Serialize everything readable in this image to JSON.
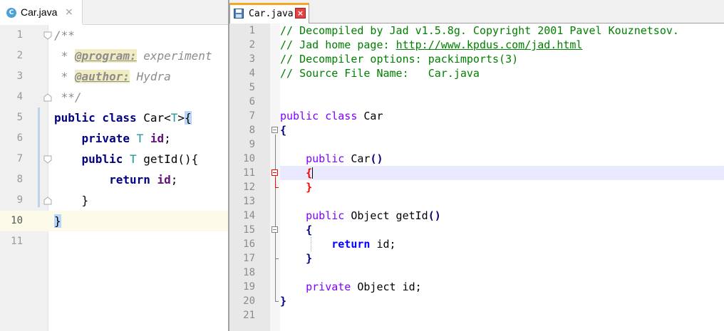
{
  "left_editor": {
    "tab": {
      "icon_letter": "C",
      "name": "Car.java",
      "close": "×"
    },
    "lines": [
      {
        "n": "1",
        "tokens": [
          {
            "c": "tk-comment",
            "t": "/**"
          }
        ]
      },
      {
        "n": "2",
        "tokens": [
          {
            "c": "tk-comment",
            "t": " * "
          },
          {
            "c": "tk-tag",
            "t": "@program:"
          },
          {
            "c": "tk-comment",
            "t": " experiment"
          }
        ]
      },
      {
        "n": "3",
        "tokens": [
          {
            "c": "tk-comment",
            "t": " * "
          },
          {
            "c": "tk-tag",
            "t": "@author:"
          },
          {
            "c": "tk-comment",
            "t": " Hydra"
          }
        ]
      },
      {
        "n": "4",
        "tokens": [
          {
            "c": "tk-comment",
            "t": " **/"
          }
        ]
      },
      {
        "n": "5",
        "tokens": [
          {
            "c": "tk-kw",
            "t": "public class "
          },
          {
            "c": "tk-ident",
            "t": "Car<"
          },
          {
            "c": "tk-type",
            "t": "T"
          },
          {
            "c": "tk-ident",
            "t": ">"
          },
          {
            "c": "tk-hl",
            "t": "{"
          }
        ]
      },
      {
        "n": "6",
        "tokens": [
          {
            "c": "tk-ident",
            "t": "    "
          },
          {
            "c": "tk-kw",
            "t": "private "
          },
          {
            "c": "tk-type",
            "t": "T "
          },
          {
            "c": "tk-field",
            "t": "id"
          },
          {
            "c": "tk-ident",
            "t": ";"
          }
        ]
      },
      {
        "n": "7",
        "tokens": [
          {
            "c": "tk-ident",
            "t": "    "
          },
          {
            "c": "tk-kw",
            "t": "public "
          },
          {
            "c": "tk-type",
            "t": "T "
          },
          {
            "c": "tk-ident",
            "t": "getId(){"
          }
        ]
      },
      {
        "n": "8",
        "tokens": [
          {
            "c": "tk-ident",
            "t": "        "
          },
          {
            "c": "tk-kw",
            "t": "return "
          },
          {
            "c": "tk-field",
            "t": "id"
          },
          {
            "c": "tk-ident",
            "t": ";"
          }
        ]
      },
      {
        "n": "9",
        "tokens": [
          {
            "c": "tk-ident",
            "t": "    }"
          }
        ]
      },
      {
        "n": "10",
        "tokens": [
          {
            "c": "tk-hl",
            "t": "}"
          }
        ],
        "active": true
      },
      {
        "n": "11",
        "tokens": []
      }
    ]
  },
  "right_editor": {
    "tab": {
      "name": "Car.java",
      "close": "×"
    },
    "current_line": 11,
    "lines": [
      {
        "n": "1",
        "tokens": [
          {
            "c": "np-comment",
            "t": "// Decompiled by Jad v1.5.8g. Copyright 2001 Pavel Kouznetsov."
          }
        ]
      },
      {
        "n": "2",
        "tokens": [
          {
            "c": "np-comment",
            "t": "// Jad home page: "
          },
          {
            "c": "np-link",
            "t": "http://www.kpdus.com/jad.html"
          }
        ]
      },
      {
        "n": "3",
        "tokens": [
          {
            "c": "np-comment",
            "t": "// Decompiler options: packimports(3)"
          }
        ]
      },
      {
        "n": "4",
        "tokens": [
          {
            "c": "np-comment",
            "t": "// Source File Name:   Car.java"
          }
        ]
      },
      {
        "n": "5",
        "tokens": []
      },
      {
        "n": "6",
        "tokens": []
      },
      {
        "n": "7",
        "tokens": [
          {
            "c": "np-kw",
            "t": "public class "
          },
          {
            "c": "np-ident",
            "t": "Car"
          }
        ]
      },
      {
        "n": "8",
        "tokens": [
          {
            "c": "np-brace",
            "t": "{"
          }
        ]
      },
      {
        "n": "9",
        "tokens": []
      },
      {
        "n": "10",
        "tokens": [
          {
            "c": "np-ident",
            "t": "    "
          },
          {
            "c": "np-kw",
            "t": "public "
          },
          {
            "c": "np-ident",
            "t": "Car"
          },
          {
            "c": "np-op",
            "t": "()"
          }
        ]
      },
      {
        "n": "11",
        "tokens": [
          {
            "c": "np-ident",
            "t": "    "
          },
          {
            "c": "np-redbrace",
            "t": "{"
          }
        ],
        "caret": true
      },
      {
        "n": "12",
        "tokens": [
          {
            "c": "np-ident",
            "t": "    "
          },
          {
            "c": "np-redbrace",
            "t": "}"
          }
        ]
      },
      {
        "n": "13",
        "tokens": []
      },
      {
        "n": "14",
        "tokens": [
          {
            "c": "np-ident",
            "t": "    "
          },
          {
            "c": "np-kw",
            "t": "public "
          },
          {
            "c": "np-ident",
            "t": "Object getId"
          },
          {
            "c": "np-op",
            "t": "()"
          }
        ]
      },
      {
        "n": "15",
        "tokens": [
          {
            "c": "np-ident",
            "t": "    "
          },
          {
            "c": "np-brace",
            "t": "{"
          }
        ]
      },
      {
        "n": "16",
        "tokens": [
          {
            "c": "np-ident",
            "t": "        "
          },
          {
            "c": "np-kwb",
            "t": "return"
          },
          {
            "c": "np-ident",
            "t": " id;"
          }
        ]
      },
      {
        "n": "17",
        "tokens": [
          {
            "c": "np-ident",
            "t": "    "
          },
          {
            "c": "np-brace",
            "t": "}"
          }
        ]
      },
      {
        "n": "18",
        "tokens": []
      },
      {
        "n": "19",
        "tokens": [
          {
            "c": "np-ident",
            "t": "    "
          },
          {
            "c": "np-kw",
            "t": "private "
          },
          {
            "c": "np-ident",
            "t": "Object id;"
          }
        ]
      },
      {
        "n": "20",
        "tokens": [
          {
            "c": "np-brace",
            "t": "}"
          }
        ]
      },
      {
        "n": "21",
        "tokens": []
      }
    ]
  }
}
